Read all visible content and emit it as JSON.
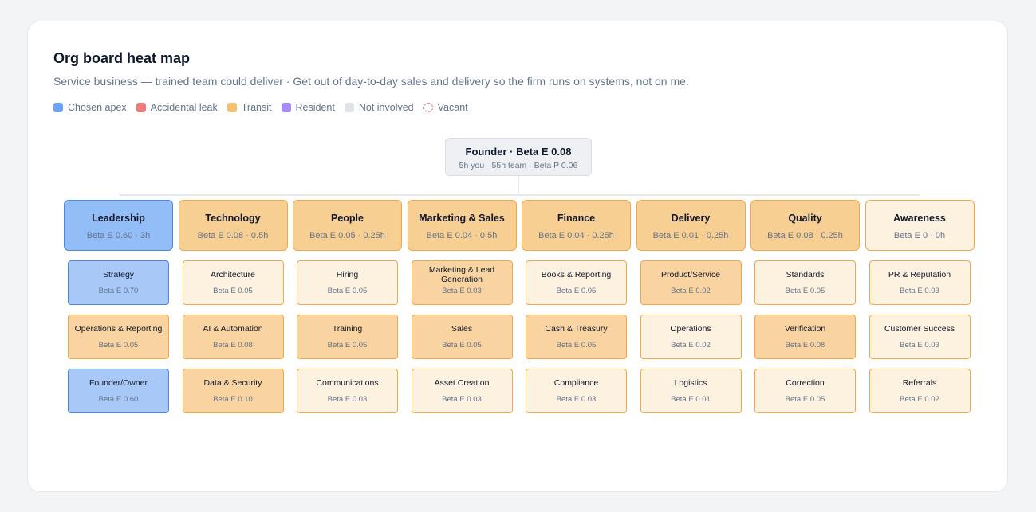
{
  "title": "Org board heat map",
  "subtitle": "Service business — trained team could deliver · Get out of day-to-day sales and delivery so the firm runs on systems, not on me.",
  "legend": [
    {
      "label": "Chosen apex",
      "color": "#6ba4f5",
      "style": "solid"
    },
    {
      "label": "Accidental leak",
      "color": "#ef7b7b",
      "style": "solid"
    },
    {
      "label": "Transit",
      "color": "#f5bf6b",
      "style": "solid"
    },
    {
      "label": "Resident",
      "color": "#a78bfa",
      "style": "solid"
    },
    {
      "label": "Not involved",
      "color": "#dfe2e7",
      "style": "solid"
    },
    {
      "label": "Vacant",
      "color": "#ef7b7b",
      "style": "dashed"
    }
  ],
  "root": {
    "title": "Founder · Beta E 0.08",
    "sub": "5h you · 55h team · Beta P 0.06"
  },
  "departments": [
    {
      "name": "Leadership",
      "meta": "Beta E 0.60 · 3h",
      "state": "apex",
      "roles": [
        {
          "name": "Strategy",
          "meta": "Beta E 0.70",
          "state": "apex"
        },
        {
          "name": "Operations & Reporting",
          "meta": "Beta E 0.05",
          "state": "transit"
        },
        {
          "name": "Founder/Owner",
          "meta": "Beta E 0.60",
          "state": "apex"
        }
      ]
    },
    {
      "name": "Technology",
      "meta": "Beta E 0.08 · 0.5h",
      "state": "transit",
      "roles": [
        {
          "name": "Architecture",
          "meta": "Beta E 0.05",
          "state": "light"
        },
        {
          "name": "AI & Automation",
          "meta": "Beta E 0.08",
          "state": "transit"
        },
        {
          "name": "Data & Security",
          "meta": "Beta E 0.10",
          "state": "transit"
        }
      ]
    },
    {
      "name": "People",
      "meta": "Beta E 0.05 · 0.25h",
      "state": "transit",
      "roles": [
        {
          "name": "Hiring",
          "meta": "Beta E 0.05",
          "state": "light"
        },
        {
          "name": "Training",
          "meta": "Beta E 0.05",
          "state": "transit"
        },
        {
          "name": "Communications",
          "meta": "Beta E 0.03",
          "state": "light"
        }
      ]
    },
    {
      "name": "Marketing & Sales",
      "meta": "Beta E 0.04 · 0.5h",
      "state": "transit",
      "roles": [
        {
          "name": "Marketing & Lead Generation",
          "meta": "Beta E 0.03",
          "state": "transit"
        },
        {
          "name": "Sales",
          "meta": "Beta E 0.05",
          "state": "transit"
        },
        {
          "name": "Asset Creation",
          "meta": "Beta E 0.03",
          "state": "light"
        }
      ]
    },
    {
      "name": "Finance",
      "meta": "Beta E 0.04 · 0.25h",
      "state": "transit",
      "roles": [
        {
          "name": "Books & Reporting",
          "meta": "Beta E 0.05",
          "state": "light"
        },
        {
          "name": "Cash & Treasury",
          "meta": "Beta E 0.05",
          "state": "transit"
        },
        {
          "name": "Compliance",
          "meta": "Beta E 0.03",
          "state": "light"
        }
      ]
    },
    {
      "name": "Delivery",
      "meta": "Beta E 0.01 · 0.25h",
      "state": "transit",
      "roles": [
        {
          "name": "Product/Service",
          "meta": "Beta E 0.02",
          "state": "transit"
        },
        {
          "name": "Operations",
          "meta": "Beta E 0.02",
          "state": "light"
        },
        {
          "name": "Logistics",
          "meta": "Beta E 0.01",
          "state": "light"
        }
      ]
    },
    {
      "name": "Quality",
      "meta": "Beta E 0.08 · 0.25h",
      "state": "transit",
      "roles": [
        {
          "name": "Standards",
          "meta": "Beta E 0.05",
          "state": "light"
        },
        {
          "name": "Verification",
          "meta": "Beta E 0.08",
          "state": "transit"
        },
        {
          "name": "Correction",
          "meta": "Beta E 0.05",
          "state": "light"
        }
      ]
    },
    {
      "name": "Awareness",
      "meta": "Beta E 0 · 0h",
      "state": "light",
      "roles": [
        {
          "name": "PR & Reputation",
          "meta": "Beta E 0.03",
          "state": "light"
        },
        {
          "name": "Customer Success",
          "meta": "Beta E 0.03",
          "state": "light"
        },
        {
          "name": "Referrals",
          "meta": "Beta E 0.02",
          "state": "light"
        }
      ]
    }
  ]
}
